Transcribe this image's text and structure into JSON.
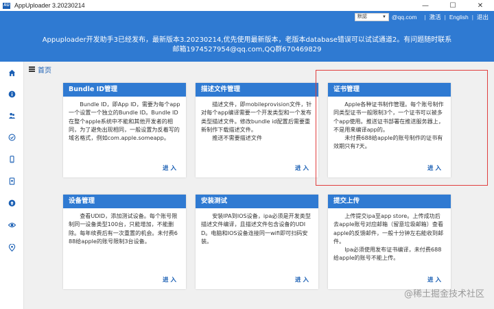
{
  "window": {
    "title": "AppUploader 3.20230214",
    "app_icon_label": "AU",
    "controls": [
      "—",
      "☐",
      "✕"
    ]
  },
  "header": {
    "account_select": "默認",
    "email_suffix": "@qq.com",
    "links": [
      "激活",
      "English",
      "退出"
    ],
    "notice_line1": "Appuploader开发助手3已经发布，最新版本3.20230214,优先使用最新版本，老版本database错误可以试试通道2。有问题随时联系",
    "notice_line2": "邮箱1974527954@qq.com,QQ群670469829"
  },
  "sidebar": {
    "items": [
      "home-icon",
      "info-icon",
      "people-icon",
      "check-icon",
      "phone-icon",
      "certificate-icon",
      "upload-icon",
      "eye-icon",
      "location-icon"
    ]
  },
  "main": {
    "page_title": "首页",
    "cards": [
      {
        "title": "Bundle ID管理",
        "body": "Bundle ID，即App ID，需要为每个app一个设置一个独立的Bundle ID。Bundle ID在整个apple系统中不能和其他开发者的相同，为了避免出现相同，一般设置为反着写的域名格式，例如com.apple.someapp。",
        "enter": "进 入"
      },
      {
        "title": "描述文件管理",
        "body": "描述文件，即mobileprovision文件，针对每个app编译需要一个开发类型和一个发布类型描述文件。修改bundle id配置后需要重新制作下载描述文件。",
        "body2": "推送不需要描述文件",
        "enter": "进 入"
      },
      {
        "title": "证书管理",
        "body": "Apple各种证书制作管理。每个账号制作同类型证书一般限制3个，一个证书可以被多个app使用。推送证书部署在推送服务器上，不是用来编译app的。",
        "body2": "未付费688给apple的账号制作的证书有效期只有7天。",
        "enter": "进 入"
      },
      {
        "title": "设备管理",
        "body": "查看UDID，添加测试设备。每个账号限制同一设备类型100台，只能增加，不能删除。每年续费后有一次重置的机会。未付费688给apple的账号限制3台设备。",
        "enter": "进 入"
      },
      {
        "title": "安装测试",
        "body": "安装IPA到IOS设备，ipa必须是开发类型描述文件编译，且描述文件包含设备的UDID。电脑和IOS设备连接同一wifi即可扫码安装。",
        "enter": "进 入"
      },
      {
        "title": "提交上传",
        "body": "上传提交ipa至app store。上传成功后去apple账号对应邮箱（留意垃圾邮箱）查看apple的反馈邮件，一般十分钟左右能收到邮件。",
        "body2": "Ipa必须使用发布证书编译，未付费688给apple的账号不能上传。",
        "enter": "进 入"
      }
    ]
  },
  "watermark": "@稀土掘金技术社区",
  "colors": {
    "header_blue": "#2f7ad2",
    "link_blue": "#1a5fb4",
    "highlight_red": "#e03c3c"
  }
}
